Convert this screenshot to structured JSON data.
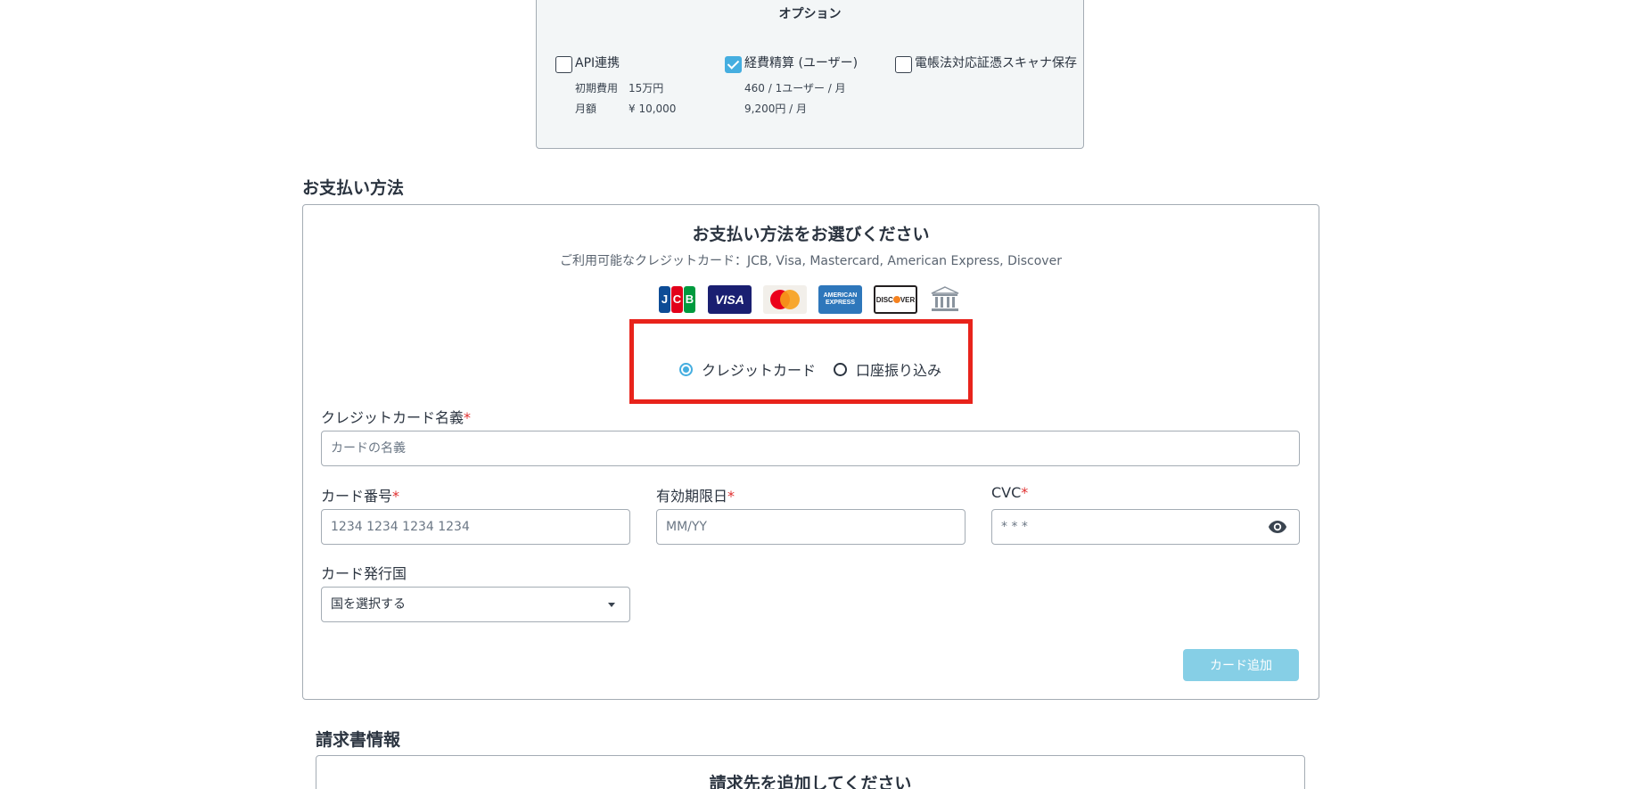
{
  "options": {
    "title": "オプション",
    "items": [
      {
        "label": "API連携",
        "checked": false,
        "details": [
          {
            "key": "初期費用",
            "value": "15万円"
          },
          {
            "key": "月額",
            "value": "¥ 10,000"
          }
        ]
      },
      {
        "label": "経費精算 (ユーザー)",
        "checked": true,
        "details": [
          {
            "key": "",
            "value": "460 / 1ユーザー / 月"
          },
          {
            "key": "",
            "value": "9,200円 / 月"
          }
        ]
      },
      {
        "label": "電帳法対応証憑スキャナ保存",
        "checked": false,
        "details": []
      }
    ]
  },
  "payment": {
    "section_title": "お支払い方法",
    "heading": "お支払い方法をお選びください",
    "subtext": "ご利用可能なクレジットカード：JCB, Visa, Mastercard, American Express, Discover",
    "card_logos": [
      "jcb-logo",
      "visa-logo",
      "mastercard-logo",
      "amex-logo",
      "discover-logo",
      "bank-icon"
    ],
    "methods": [
      {
        "label": "クレジットカード",
        "selected": true
      },
      {
        "label": "口座振り込み",
        "selected": false
      }
    ],
    "fields": {
      "card_name": {
        "label": "クレジットカード名義",
        "required_mark": "*",
        "placeholder": "カードの名義"
      },
      "card_number": {
        "label": "カード番号",
        "required_mark": "*",
        "placeholder": "1234 1234 1234 1234"
      },
      "expiry": {
        "label": "有効期限日",
        "required_mark": "*",
        "placeholder": "MM/YY"
      },
      "cvc": {
        "label": "CVC",
        "required_mark": "*",
        "placeholder": "* * *"
      },
      "country": {
        "label": "カード発行国",
        "value": "国を選択する"
      }
    },
    "add_card_label": "カード追加",
    "colors": {
      "accent": "#45aee0",
      "highlight": "#e8231b",
      "button_disabled": "#86cfe6"
    }
  },
  "invoice": {
    "section_title": "請求書情報",
    "heading": "請求先を追加してください"
  }
}
